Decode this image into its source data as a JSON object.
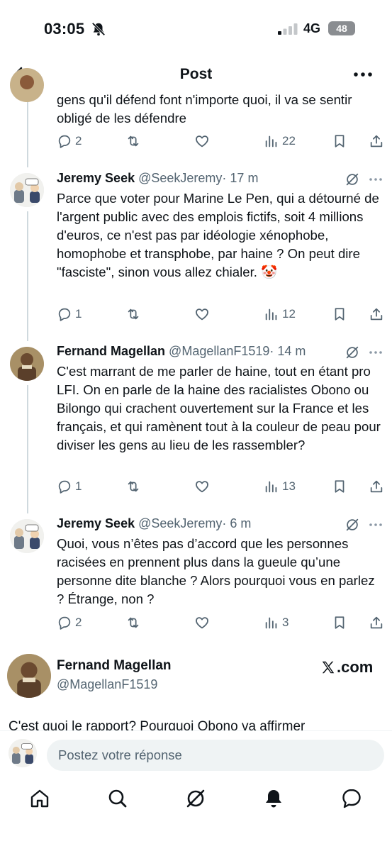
{
  "status_bar": {
    "time": "03:05",
    "network": "4G",
    "battery": "48"
  },
  "header": {
    "title": "Post"
  },
  "tweets": [
    {
      "text": "gens qu'il défend font n'importe quoi, il va se sentir obligé de les défendre",
      "replies": "2",
      "reposts": "",
      "likes": "",
      "views": "22"
    },
    {
      "name": "Jeremy Seek",
      "handle": "@SeekJeremy",
      "time": "· 17 m",
      "text": "Parce que voter pour Marine Le Pen, qui a détourné de l'argent public avec des emplois fictifs, soit 4 millions d'euros, ce n'est pas par idéologie xénophobe, homophobe et transphobe, par haine ? On peut dire \"fasciste\", sinon vous allez chialer. 🤡",
      "replies": "1",
      "reposts": "",
      "likes": "",
      "views": "12"
    },
    {
      "name": "Fernand Magellan",
      "handle": "@MagellanF1519",
      "time": "· 14 m",
      "text": "C'est marrant de me parler de haine, tout en étant pro LFI. On en parle de la haine des racialistes Obono ou Bilongo qui crachent ouvertement sur la France et les français, et qui ramènent tout à la couleur de peau pour diviser les gens au lieu de les rassembler?",
      "replies": "1",
      "reposts": "",
      "likes": "",
      "views": "13"
    },
    {
      "name": "Jeremy Seek",
      "handle": "@SeekJeremy",
      "time": "· 6 m",
      "text": "Quoi, vous n’êtes pas d’accord que les personnes racisées en prennent plus dans la gueule qu’une personne dite blanche ? Alors pourquoi vous en parlez ? Étrange, non ?",
      "replies": "2",
      "reposts": "",
      "likes": "",
      "views": "3"
    }
  ],
  "focused": {
    "name": "Fernand Magellan",
    "handle": "@MagellanF1519",
    "brand": ".com",
    "text": "C'est quoi le rapport? Pourquoi Obono va affirmer"
  },
  "reply": {
    "placeholder": "Postez votre réponse"
  },
  "icons": {
    "back": "arrow-left-icon",
    "more": "more-horizontal-icon",
    "reply": "reply-bubble-icon",
    "repost": "repost-icon",
    "like": "heart-icon",
    "views": "views-bar-icon",
    "bookmark": "bookmark-icon",
    "share": "share-icon",
    "grok": "grok-icon",
    "home": "home-icon",
    "search": "search-icon",
    "notifications": "bell-icon",
    "messages": "chat-icon"
  },
  "colors": {
    "text": "#0f1419",
    "secondary": "#536471",
    "thread_line": "#cfd9de",
    "input_bg": "#eff3f4"
  }
}
